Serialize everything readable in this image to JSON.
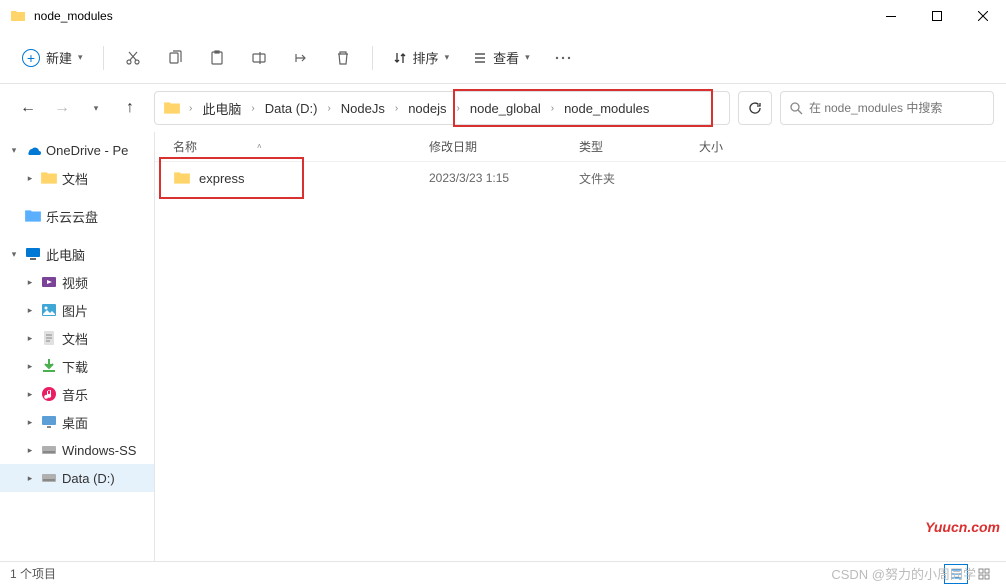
{
  "window": {
    "title": "node_modules"
  },
  "toolbar": {
    "new_label": "新建",
    "sort_label": "排序",
    "view_label": "查看"
  },
  "breadcrumb": {
    "segments": [
      "此电脑",
      "Data (D:)",
      "NodeJs",
      "nodejs",
      "node_global",
      "node_modules"
    ]
  },
  "search": {
    "placeholder": "在 node_modules 中搜索"
  },
  "sidebar": {
    "items": [
      {
        "label": "OneDrive - Pe",
        "icon": "onedrive",
        "chev": "down",
        "indent": 0
      },
      {
        "label": "文档",
        "icon": "folder",
        "chev": "right",
        "indent": 1
      },
      {
        "label": "乐云云盘",
        "icon": "folder-blue",
        "chev": "none",
        "indent": 0,
        "spacer_before": true
      },
      {
        "label": "此电脑",
        "icon": "pc",
        "chev": "down",
        "indent": 0,
        "spacer_before": true
      },
      {
        "label": "视频",
        "icon": "video",
        "chev": "right",
        "indent": 1
      },
      {
        "label": "图片",
        "icon": "picture",
        "chev": "right",
        "indent": 1
      },
      {
        "label": "文档",
        "icon": "document",
        "chev": "right",
        "indent": 1
      },
      {
        "label": "下载",
        "icon": "download",
        "chev": "right",
        "indent": 1
      },
      {
        "label": "音乐",
        "icon": "music",
        "chev": "right",
        "indent": 1
      },
      {
        "label": "桌面",
        "icon": "desktop",
        "chev": "right",
        "indent": 1
      },
      {
        "label": "Windows-SS",
        "icon": "disk",
        "chev": "right",
        "indent": 1
      },
      {
        "label": "Data (D:)",
        "icon": "disk",
        "chev": "right",
        "indent": 1,
        "selected": true
      }
    ]
  },
  "columns": {
    "name": "名称",
    "date": "修改日期",
    "type": "类型",
    "size": "大小"
  },
  "files": [
    {
      "name": "express",
      "date": "2023/3/23 1:15",
      "type": "文件夹",
      "icon": "folder"
    }
  ],
  "statusbar": {
    "count": "1 个项目"
  },
  "watermarks": {
    "w1": "Yuucn.com",
    "w2": "CSDN @努力的小周同学"
  }
}
